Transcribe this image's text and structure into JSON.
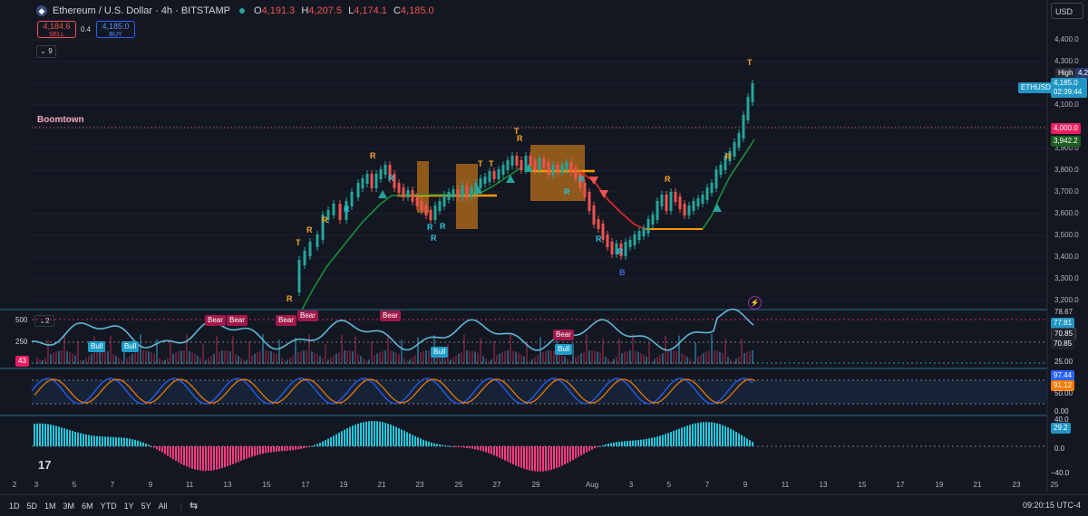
{
  "header": {
    "symbol_title": "Ethereum / U.S. Dollar · 4h · BITSTAMP",
    "ohlc": [
      {
        "label": "O",
        "value": "4,191.3"
      },
      {
        "label": "H",
        "value": "4,207.5"
      },
      {
        "label": "L",
        "value": "4,174.1"
      },
      {
        "label": "C",
        "value": "4,185.0"
      }
    ],
    "sell_price": "4,184.6",
    "sell_label": "SELL",
    "spread": "0.4",
    "buy_price": "4,185.0",
    "buy_label": "BUY",
    "indicators_count": "9"
  },
  "currency": "USD",
  "price_axis": {
    "ticks": [
      "4,400.0",
      "4,300.0",
      "4,200.0",
      "4,100.0",
      "4,000.0",
      "3,900.0",
      "3,800.0",
      "3,700.0",
      "3,600.0",
      "3,500.0",
      "3,400.0",
      "3,300.0",
      "3,200.0"
    ],
    "tags": {
      "high_label": "High",
      "high_value": "4,249.0",
      "symbol_tag": "ETHUSD",
      "last_price": "4,185.0",
      "countdown": "02:39:44",
      "level_boomtown": "4,000.0",
      "ma_value": "3,942.2"
    }
  },
  "boomtown_label": "Boomtown",
  "rsi_pane": {
    "label_count": "2",
    "left_axis": [
      "500",
      "250"
    ],
    "left_value": "43",
    "right_values": [
      "78.67",
      "77.81",
      "70.85",
      "70.85",
      "25.00"
    ],
    "bear_labels": [
      "Bear",
      "Bear",
      "Bear",
      "Bear",
      "Bear",
      "Bear"
    ],
    "bull_labels": [
      "Bull",
      "Bull",
      "Bull",
      "Bull"
    ]
  },
  "stoch_pane": {
    "right_values": [
      "97.44",
      "91.12",
      "50.00",
      "0.00"
    ]
  },
  "macd_pane": {
    "right_values": [
      "40.0",
      "29.2",
      "0.0",
      "−40.0"
    ]
  },
  "signals": {
    "T": "T",
    "R": "R",
    "B": "B"
  },
  "date_axis": [
    "2",
    "3",
    "5",
    "7",
    "9",
    "11",
    "13",
    "15",
    "17",
    "19",
    "21",
    "23",
    "25",
    "27",
    "29",
    "Aug",
    "3",
    "5",
    "7",
    "9",
    "11",
    "13",
    "15",
    "17",
    "19",
    "21",
    "23",
    "25"
  ],
  "bottom_bar": {
    "timeframes": [
      "1D",
      "5D",
      "1M",
      "3M",
      "6M",
      "YTD",
      "1Y",
      "5Y",
      "All"
    ],
    "clock": "09:20:15 UTC-4"
  },
  "colors": {
    "background": "#131722",
    "bull": "#26a69a",
    "bear": "#ef5350",
    "trend_green": "#1b8c3a",
    "trend_red": "#c62828",
    "box_orange": "#b8701a",
    "rsi_line": "#5fb7d6",
    "boomtown": "#ff4d88"
  }
}
